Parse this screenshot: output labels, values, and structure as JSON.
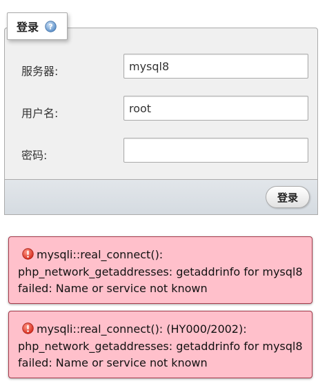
{
  "login": {
    "legend_title": "登录",
    "help_icon": "help-icon",
    "server_label": "服务器:",
    "server_value": "mysql8",
    "username_label": "用户名:",
    "username_value": "root",
    "password_label": "密码:",
    "password_value": "",
    "submit_label": "登录"
  },
  "errors": [
    {
      "icon": "error-icon",
      "line1": "mysqli::real_connect():",
      "line2": "php_network_getaddresses: getaddrinfo for mysql8",
      "line3": "failed: Name or service not known"
    },
    {
      "icon": "error-icon",
      "line1": "mysqli::real_connect(): (HY000/2002):",
      "line2": "php_network_getaddresses: getaddrinfo for mysql8",
      "line3": "failed: Name or service not known"
    }
  ],
  "colors": {
    "error_background": "#ffc0cb",
    "error_border": "#a33a4a",
    "fieldset_background": "#f0f0f0",
    "footer_background": "#d9dee3"
  }
}
